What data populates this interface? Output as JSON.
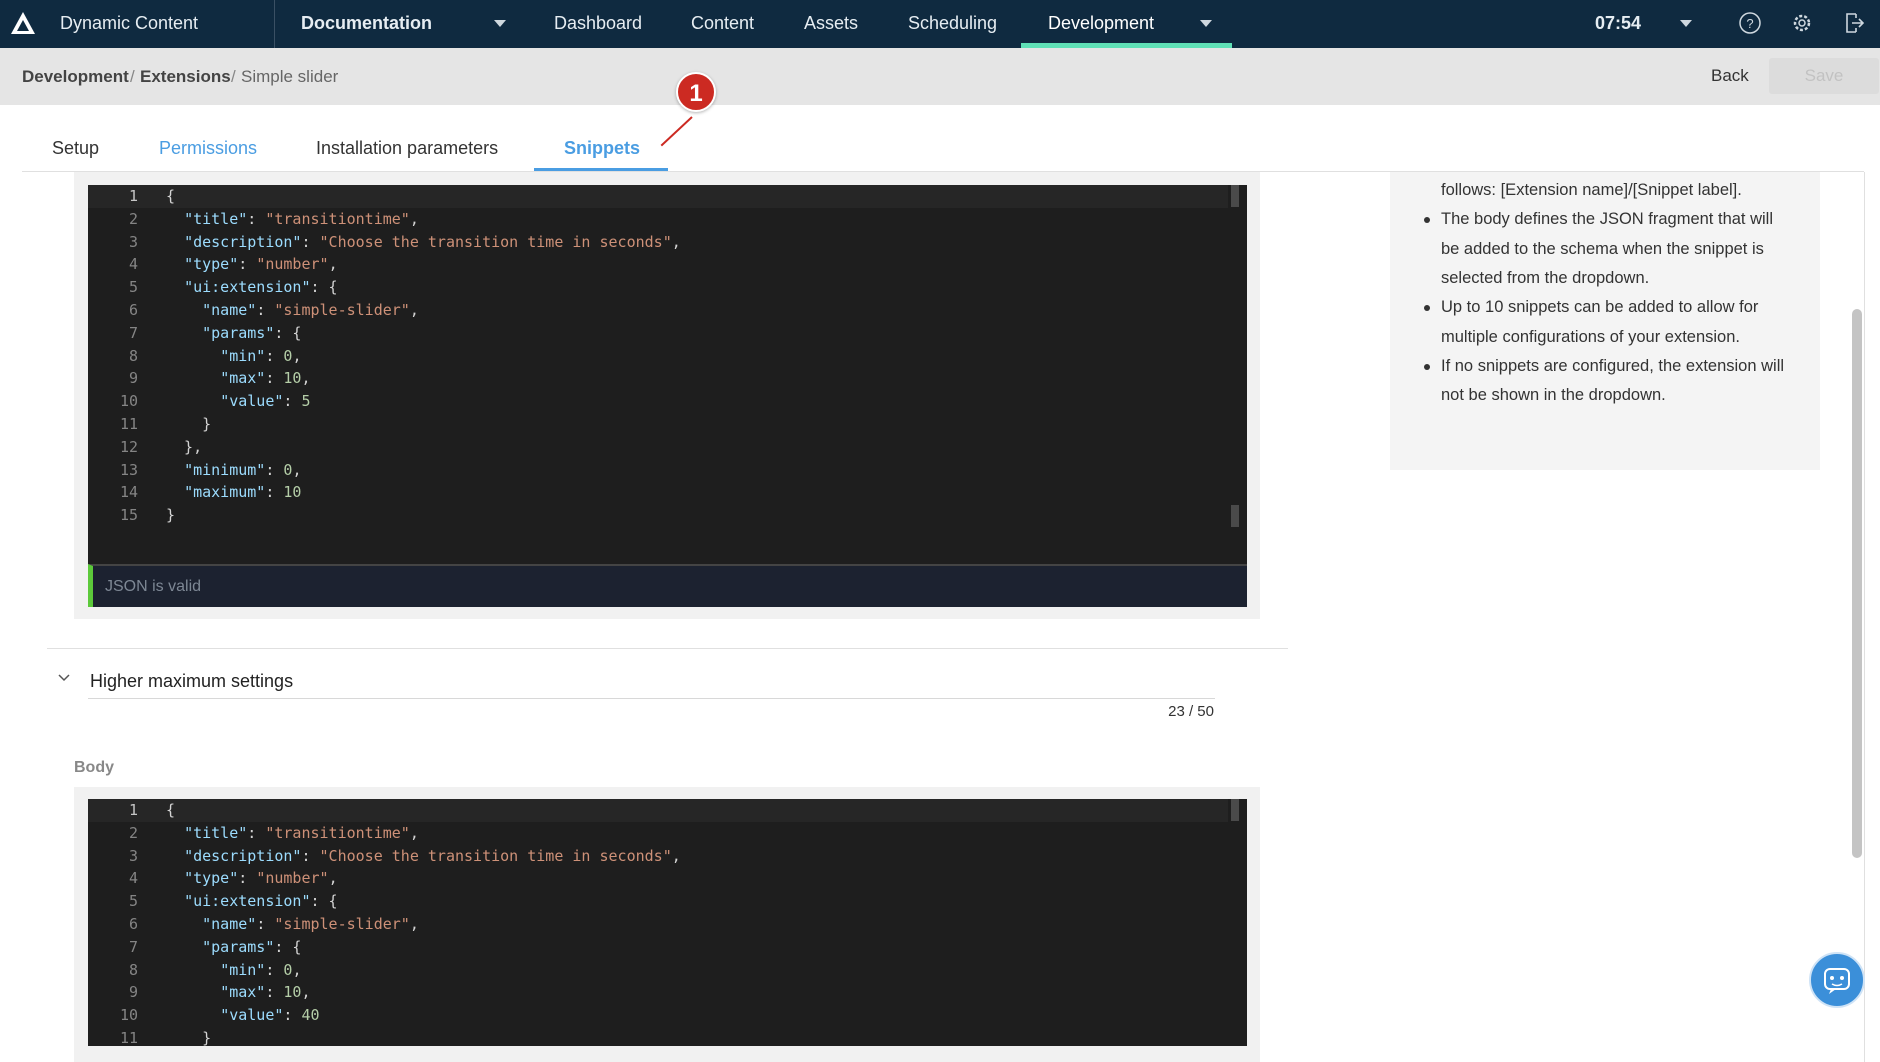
{
  "nav": {
    "app_title": "Dynamic Content",
    "hub": "Documentation",
    "items": [
      "Dashboard",
      "Content",
      "Assets",
      "Scheduling",
      "Development"
    ],
    "active": "Development",
    "time": "07:54",
    "accent": "#5fe0b6",
    "bg": "#0f2a40"
  },
  "breadcrumb": {
    "items": [
      "Development",
      "Extensions",
      "Simple slider"
    ],
    "back": "Back",
    "save": "Save"
  },
  "tabs": {
    "items": [
      "Setup",
      "Permissions",
      "Installation parameters",
      "Snippets"
    ],
    "active": "Snippets"
  },
  "annotation": {
    "number": "1"
  },
  "editor1": {
    "status": "JSON is valid",
    "lines": [
      [
        [
          "p",
          "{"
        ]
      ],
      [
        [
          "p",
          "  "
        ],
        [
          "k",
          "\"title\""
        ],
        [
          "p",
          ": "
        ],
        [
          "s",
          "\"transitiontime\""
        ],
        [
          "p",
          ","
        ]
      ],
      [
        [
          "p",
          "  "
        ],
        [
          "k",
          "\"description\""
        ],
        [
          "p",
          ": "
        ],
        [
          "s",
          "\"Choose the transition time in seconds\""
        ],
        [
          "p",
          ","
        ]
      ],
      [
        [
          "p",
          "  "
        ],
        [
          "k",
          "\"type\""
        ],
        [
          "p",
          ": "
        ],
        [
          "s",
          "\"number\""
        ],
        [
          "p",
          ","
        ]
      ],
      [
        [
          "p",
          "  "
        ],
        [
          "k",
          "\"ui:extension\""
        ],
        [
          "p",
          ": {"
        ]
      ],
      [
        [
          "p",
          "    "
        ],
        [
          "k",
          "\"name\""
        ],
        [
          "p",
          ": "
        ],
        [
          "s",
          "\"simple-slider\""
        ],
        [
          "p",
          ","
        ]
      ],
      [
        [
          "p",
          "    "
        ],
        [
          "k",
          "\"params\""
        ],
        [
          "p",
          ": {"
        ]
      ],
      [
        [
          "p",
          "      "
        ],
        [
          "k",
          "\"min\""
        ],
        [
          "p",
          ": "
        ],
        [
          "n",
          "0"
        ],
        [
          "p",
          ","
        ]
      ],
      [
        [
          "p",
          "      "
        ],
        [
          "k",
          "\"max\""
        ],
        [
          "p",
          ": "
        ],
        [
          "n",
          "10"
        ],
        [
          "p",
          ","
        ]
      ],
      [
        [
          "p",
          "      "
        ],
        [
          "k",
          "\"value\""
        ],
        [
          "p",
          ": "
        ],
        [
          "n",
          "5"
        ]
      ],
      [
        [
          "p",
          "    }"
        ]
      ],
      [
        [
          "p",
          "  },"
        ]
      ],
      [
        [
          "p",
          "  "
        ],
        [
          "k",
          "\"minimum\""
        ],
        [
          "p",
          ": "
        ],
        [
          "n",
          "0"
        ],
        [
          "p",
          ","
        ]
      ],
      [
        [
          "p",
          "  "
        ],
        [
          "k",
          "\"maximum\""
        ],
        [
          "p",
          ": "
        ],
        [
          "n",
          "10"
        ]
      ],
      [
        [
          "p",
          "}"
        ]
      ]
    ]
  },
  "snippet2": {
    "label": "Higher maximum settings",
    "counter": "23 / 50",
    "body_label": "Body"
  },
  "editor2": {
    "lines": [
      [
        [
          "p",
          "{"
        ]
      ],
      [
        [
          "p",
          "  "
        ],
        [
          "k",
          "\"title\""
        ],
        [
          "p",
          ": "
        ],
        [
          "s",
          "\"transitiontime\""
        ],
        [
          "p",
          ","
        ]
      ],
      [
        [
          "p",
          "  "
        ],
        [
          "k",
          "\"description\""
        ],
        [
          "p",
          ": "
        ],
        [
          "s",
          "\"Choose the transition time in seconds\""
        ],
        [
          "p",
          ","
        ]
      ],
      [
        [
          "p",
          "  "
        ],
        [
          "k",
          "\"type\""
        ],
        [
          "p",
          ": "
        ],
        [
          "s",
          "\"number\""
        ],
        [
          "p",
          ","
        ]
      ],
      [
        [
          "p",
          "  "
        ],
        [
          "k",
          "\"ui:extension\""
        ],
        [
          "p",
          ": {"
        ]
      ],
      [
        [
          "p",
          "    "
        ],
        [
          "k",
          "\"name\""
        ],
        [
          "p",
          ": "
        ],
        [
          "s",
          "\"simple-slider\""
        ],
        [
          "p",
          ","
        ]
      ],
      [
        [
          "p",
          "    "
        ],
        [
          "k",
          "\"params\""
        ],
        [
          "p",
          ": {"
        ]
      ],
      [
        [
          "p",
          "      "
        ],
        [
          "k",
          "\"min\""
        ],
        [
          "p",
          ": "
        ],
        [
          "n",
          "0"
        ],
        [
          "p",
          ","
        ]
      ],
      [
        [
          "p",
          "      "
        ],
        [
          "k",
          "\"max\""
        ],
        [
          "p",
          ": "
        ],
        [
          "n",
          "10"
        ],
        [
          "p",
          ","
        ]
      ],
      [
        [
          "p",
          "      "
        ],
        [
          "k",
          "\"value\""
        ],
        [
          "p",
          ": "
        ],
        [
          "n",
          "40"
        ]
      ],
      [
        [
          "p",
          "    }"
        ]
      ]
    ]
  },
  "help": {
    "lines": [
      {
        "bullet": false,
        "text": "follows: [Extension name]/[Snippet label]."
      },
      {
        "bullet": true,
        "text": "The body defines the JSON fragment that will"
      },
      {
        "bullet": false,
        "text": "be added to the schema when the snippet is"
      },
      {
        "bullet": false,
        "text": "selected from the dropdown."
      },
      {
        "bullet": true,
        "text": "Up to 10 snippets can be added to allow for"
      },
      {
        "bullet": false,
        "text": "multiple configurations of your extension."
      },
      {
        "bullet": true,
        "text": "If no snippets are configured, the extension will"
      },
      {
        "bullet": false,
        "text": "not be shown in the dropdown."
      }
    ]
  },
  "icons": [
    "logo-icon",
    "caret-down-icon",
    "help-icon",
    "gear-icon",
    "logout-icon",
    "chevron-down-icon",
    "chatbot-icon"
  ]
}
